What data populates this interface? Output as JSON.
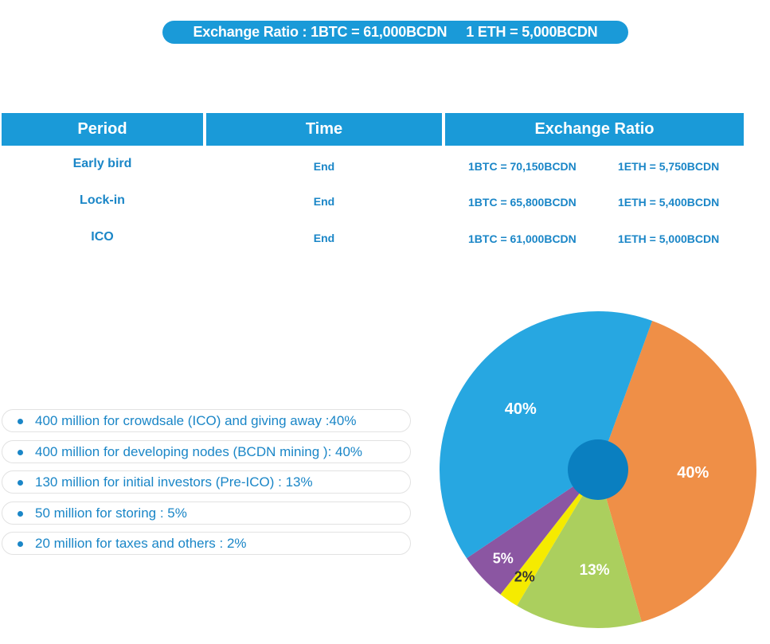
{
  "banner": {
    "text": "Exchange Ratio : 1BTC = 61,000BCDN     1 ETH = 5,000BCDN"
  },
  "table": {
    "headers": [
      "Period",
      "Time",
      "Exchange Ratio"
    ],
    "rows": [
      {
        "period": "Early bird",
        "time": "End",
        "btc": "1BTC = 70,150BCDN",
        "eth": "1ETH = 5,750BCDN"
      },
      {
        "period": "Lock-in",
        "time": "End",
        "btc": "1BTC = 65,800BCDN",
        "eth": "1ETH = 5,400BCDN"
      },
      {
        "period": "ICO",
        "time": "End",
        "btc": "1BTC = 61,000BCDN",
        "eth": "1ETH = 5,000BCDN"
      }
    ]
  },
  "legend": [
    "400 million for crowdsale (ICO) and giving away :40%",
    "400 million for developing nodes (BCDN mining ): 40%",
    "130 million for initial investors (Pre-ICO) : 13%",
    "50 million for storing : 5%",
    "20 million for taxes and others : 2%"
  ],
  "chart_data": {
    "type": "pie",
    "title": "",
    "slices": [
      {
        "label": "40%",
        "value": 40,
        "color": "#ef8f47"
      },
      {
        "label": "13%",
        "value": 13,
        "color": "#abcf5e"
      },
      {
        "label": "2%",
        "value": 2,
        "color": "#f5eb00"
      },
      {
        "label": "5%",
        "value": 5,
        "color": "#8b56a2"
      },
      {
        "label": "40%",
        "value": 40,
        "color": "#27a7e1"
      }
    ],
    "center_color": "#0a7fc0"
  }
}
